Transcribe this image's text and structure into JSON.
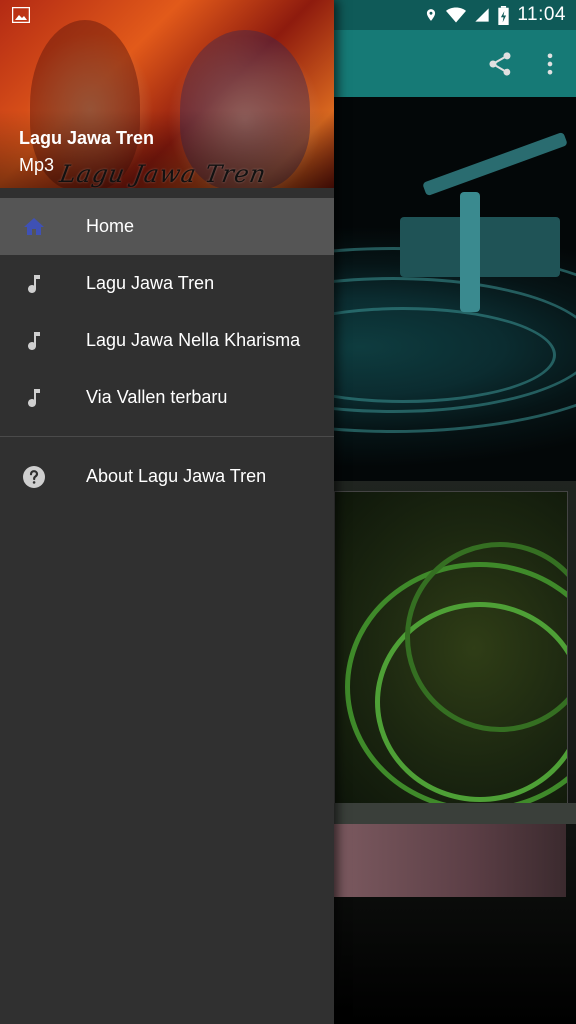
{
  "status_bar": {
    "time": "11:04",
    "icons": [
      "gallery-notification-icon",
      "location-icon",
      "wifi-icon",
      "signal-icon",
      "battery-icon"
    ]
  },
  "toolbar": {
    "icons": [
      "share-icon",
      "more-vert-icon"
    ]
  },
  "drawer": {
    "header": {
      "title": "Lagu Jawa Tren",
      "subtitle": "Mp3",
      "watermark": "Lagu Jawa Tren"
    },
    "items": [
      {
        "label": "Home",
        "icon": "home-icon",
        "active": true
      },
      {
        "label": "Lagu Jawa Tren",
        "icon": "music-note-icon",
        "active": false
      },
      {
        "label": "Lagu Jawa Nella Kharisma",
        "icon": "music-note-icon",
        "active": false
      },
      {
        "label": "Via Vallen terbaru",
        "icon": "music-note-icon",
        "active": false
      }
    ],
    "footer_items": [
      {
        "label": "About Lagu Jawa Tren",
        "icon": "help-icon"
      }
    ]
  },
  "colors": {
    "toolbar": "#167a76",
    "status_bar": "#0f5a58",
    "drawer_bg": "#303030",
    "active_item_bg": "#555555",
    "home_icon": "#3f51b5"
  }
}
